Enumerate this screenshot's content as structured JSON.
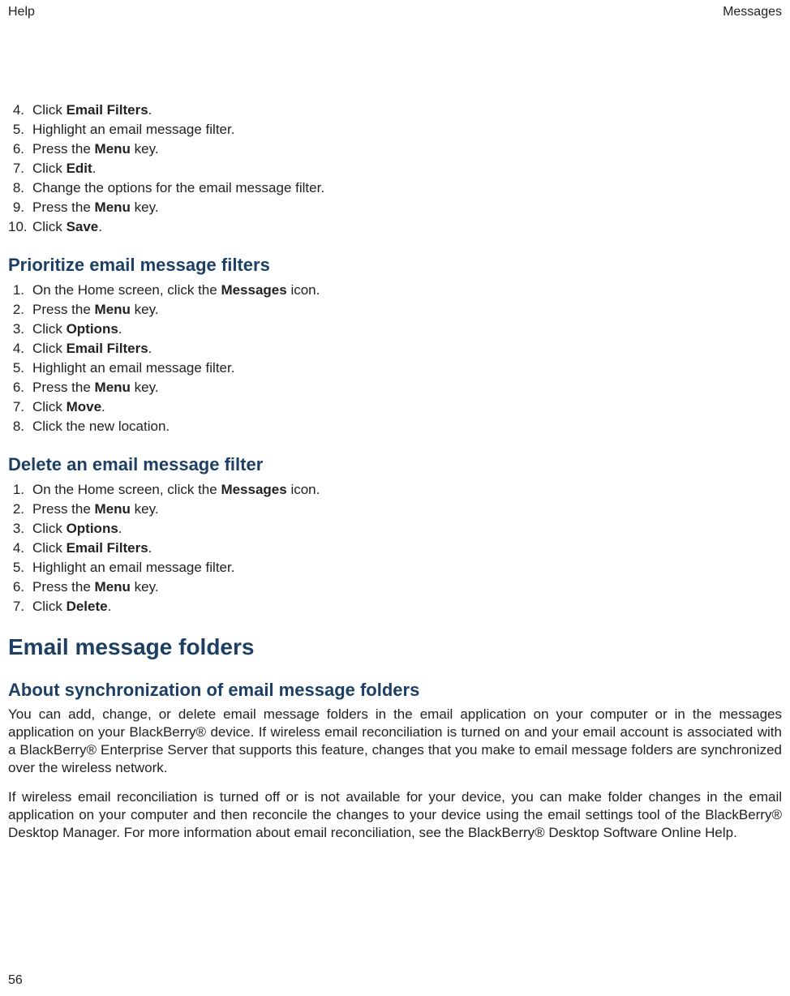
{
  "header": {
    "left": "Help",
    "right": "Messages"
  },
  "section1": {
    "items": [
      {
        "n": "4.",
        "pre": "Click ",
        "bold": "Email Filters",
        "post": "."
      },
      {
        "n": "5.",
        "pre": "Highlight an email message filter.",
        "bold": "",
        "post": ""
      },
      {
        "n": "6.",
        "pre": "Press the ",
        "bold": "Menu",
        "post": " key."
      },
      {
        "n": "7.",
        "pre": "Click ",
        "bold": "Edit",
        "post": "."
      },
      {
        "n": "8.",
        "pre": "Change the options for the email message filter.",
        "bold": "",
        "post": ""
      },
      {
        "n": "9.",
        "pre": "Press the ",
        "bold": "Menu",
        "post": " key."
      },
      {
        "n": "10.",
        "pre": "Click ",
        "bold": "Save",
        "post": "."
      }
    ]
  },
  "section2": {
    "title": "Prioritize email message filters",
    "items": [
      {
        "n": "1.",
        "pre": "On the Home screen, click the ",
        "bold": "Messages",
        "post": " icon."
      },
      {
        "n": "2.",
        "pre": "Press the ",
        "bold": "Menu",
        "post": " key."
      },
      {
        "n": "3.",
        "pre": "Click ",
        "bold": "Options",
        "post": "."
      },
      {
        "n": "4.",
        "pre": "Click ",
        "bold": "Email Filters",
        "post": "."
      },
      {
        "n": "5.",
        "pre": "Highlight an email message filter.",
        "bold": "",
        "post": ""
      },
      {
        "n": "6.",
        "pre": "Press the ",
        "bold": "Menu",
        "post": " key."
      },
      {
        "n": "7.",
        "pre": "Click ",
        "bold": "Move",
        "post": "."
      },
      {
        "n": "8.",
        "pre": "Click the new location.",
        "bold": "",
        "post": ""
      }
    ]
  },
  "section3": {
    "title": "Delete an email message filter",
    "items": [
      {
        "n": "1.",
        "pre": "On the Home screen, click the ",
        "bold": "Messages",
        "post": " icon."
      },
      {
        "n": "2.",
        "pre": "Press the ",
        "bold": "Menu",
        "post": " key."
      },
      {
        "n": "3.",
        "pre": "Click ",
        "bold": "Options",
        "post": "."
      },
      {
        "n": "4.",
        "pre": "Click ",
        "bold": "Email Filters",
        "post": "."
      },
      {
        "n": "5.",
        "pre": "Highlight an email message filter.",
        "bold": "",
        "post": ""
      },
      {
        "n": "6.",
        "pre": "Press the ",
        "bold": "Menu",
        "post": " key."
      },
      {
        "n": "7.",
        "pre": "Click ",
        "bold": "Delete",
        "post": "."
      }
    ]
  },
  "section4": {
    "main_title": "Email message folders",
    "sub_title": "About synchronization of email message folders",
    "para1": "You can add, change, or delete email message folders in the email application on your computer or in the messages application on your BlackBerry® device. If wireless email reconciliation is turned on and your email account is associated with a BlackBerry® Enterprise Server that supports this feature, changes that you make to email message folders are synchronized over the wireless network.",
    "para2": "If wireless email reconciliation is turned off or is not available for your device, you can make folder changes in the email application on your computer and then reconcile the changes to your device using the email settings tool of the BlackBerry® Desktop Manager. For more information about email reconciliation, see the BlackBerry® Desktop Software Online Help."
  },
  "page_number": "56"
}
